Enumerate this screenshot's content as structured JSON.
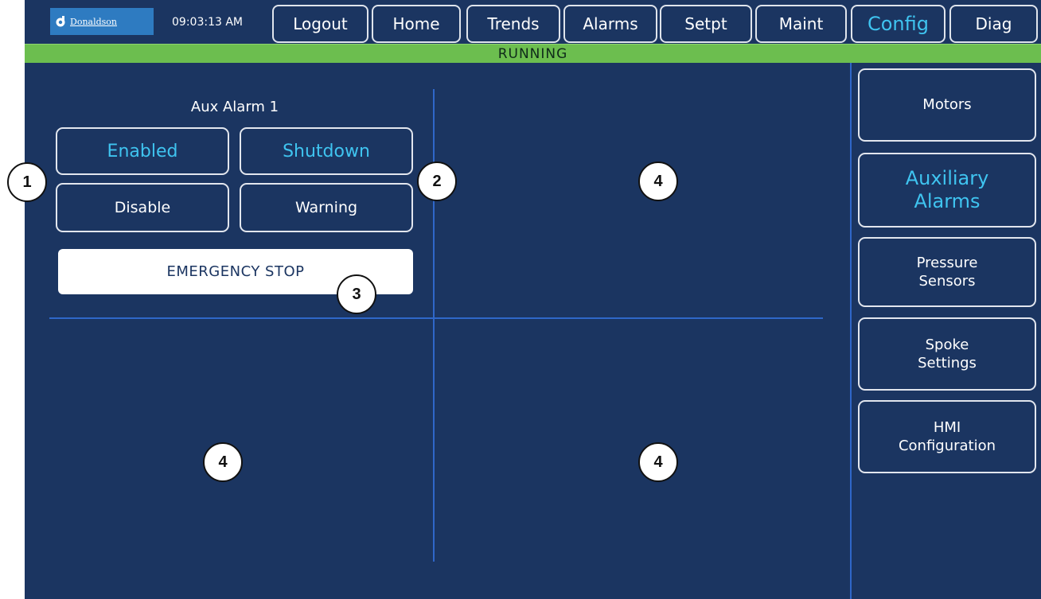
{
  "header": {
    "logo_text": "Donaldson",
    "clock": "09:03:13 AM",
    "nav": [
      {
        "label": "Logout"
      },
      {
        "label": "Home"
      },
      {
        "label": "Trends"
      },
      {
        "label": "Alarms"
      },
      {
        "label": "Setpt"
      },
      {
        "label": "Maint"
      },
      {
        "label": "Config",
        "active": true
      },
      {
        "label": "Diag"
      }
    ]
  },
  "status": {
    "text": "RUNNING",
    "color": "#6cbe4f"
  },
  "aux_alarm": {
    "title": "Aux Alarm 1",
    "enabled_label": "Enabled",
    "shutdown_label": "Shutdown",
    "disable_label": "Disable",
    "warning_label": "Warning",
    "estop_label": "EMERGENCY STOP"
  },
  "sidebar": {
    "items": [
      {
        "label": "Motors"
      },
      {
        "label": "Auxiliary Alarms",
        "active": true
      },
      {
        "label": "Pressure Sensors"
      },
      {
        "label": "Spoke Settings"
      },
      {
        "label": "HMI Configuration"
      }
    ]
  },
  "callouts": [
    "1",
    "2",
    "3",
    "4",
    "4",
    "4"
  ],
  "colors": {
    "panel": "#1b3561",
    "accent": "#3fc4f0",
    "divider": "#2f67c9",
    "status_green": "#6cbe4f"
  },
  "icons": [
    "donaldson-logo-icon"
  ]
}
